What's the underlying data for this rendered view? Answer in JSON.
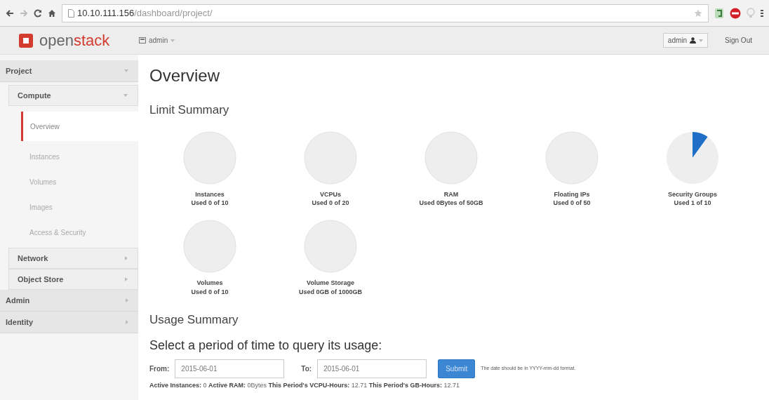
{
  "browser": {
    "url_host": "10.10.111.156",
    "url_path": "/dashboard/project/"
  },
  "navbar": {
    "logo_text_a": "open",
    "logo_text_b": "stack",
    "project_menu": "admin",
    "user_menu": "admin",
    "sign_out": "Sign Out"
  },
  "sidebar": [
    {
      "label": "Project",
      "expanded": true,
      "children": [
        {
          "label": "Compute",
          "expanded": true,
          "children": [
            {
              "label": "Overview",
              "selected": true
            },
            {
              "label": "Instances",
              "selected": false
            },
            {
              "label": "Volumes",
              "selected": false
            },
            {
              "label": "Images",
              "selected": false
            },
            {
              "label": "Access & Security",
              "selected": false
            }
          ]
        },
        {
          "label": "Network",
          "expanded": false
        },
        {
          "label": "Object Store",
          "expanded": false
        }
      ]
    },
    {
      "label": "Admin",
      "expanded": false
    },
    {
      "label": "Identity",
      "expanded": false
    }
  ],
  "page_title": "Overview",
  "limit_summary": {
    "heading": "Limit Summary",
    "limits": [
      {
        "name": "Instances",
        "usage": "Used 0 of 10",
        "chart_data": {
          "type": "pie",
          "values": [
            0,
            100
          ]
        }
      },
      {
        "name": "VCPUs",
        "usage": "Used 0 of 20",
        "chart_data": {
          "type": "pie",
          "values": [
            0,
            100
          ]
        }
      },
      {
        "name": "RAM",
        "usage": "Used 0Bytes of 50GB",
        "chart_data": {
          "type": "pie",
          "values": [
            0,
            100
          ]
        }
      },
      {
        "name": "Floating IPs",
        "usage": "Used 0 of 50",
        "chart_data": {
          "type": "pie",
          "values": [
            0,
            100
          ]
        }
      },
      {
        "name": "Security Groups",
        "usage": "Used 1 of 10",
        "chart_data": {
          "type": "pie",
          "values": [
            10,
            90
          ]
        }
      },
      {
        "name": "Volumes",
        "usage": "Used 0 of 10",
        "chart_data": {
          "type": "pie",
          "values": [
            0,
            100
          ]
        }
      },
      {
        "name": "Volume Storage",
        "usage": "Used 0GB of 1000GB",
        "chart_data": {
          "type": "pie",
          "values": [
            0,
            100
          ]
        }
      }
    ]
  },
  "usage_summary": {
    "heading": "Usage Summary",
    "query_heading": "Select a period of time to query its usage:",
    "from_label": "From:",
    "from_value": "2015-06-01",
    "to_label": "To:",
    "to_value": "2015-06-01",
    "submit": "Submit",
    "hint": "The date should be in YYYY-mm-dd format.",
    "totals": "**Active Instances:** 0 **Active RAM:** 0Bytes **This Period's VCPU-Hours:** 12.71 **This Period's GB-Hours:** 12.71"
  }
}
